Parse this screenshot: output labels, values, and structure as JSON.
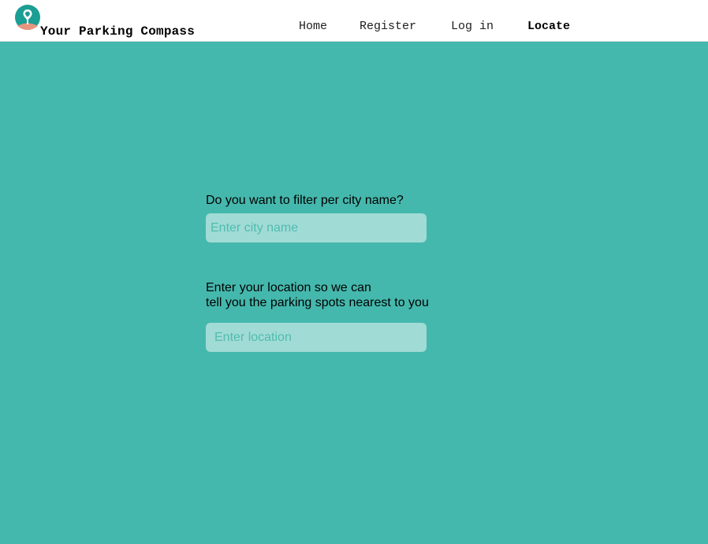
{
  "header": {
    "brand": "Your Parking Compass",
    "logo_icon": "map-pin-icon",
    "nav": {
      "home": "Home",
      "register": "Register",
      "login": "Log in",
      "locate": "Locate"
    },
    "active_nav": "locate"
  },
  "form": {
    "city_question": "Do you want to filter per city name?",
    "city_placeholder": "Enter city name",
    "location_prompt_line1": "Enter your location so we can",
    "location_prompt_line2": "tell you the parking spots nearest to you",
    "location_placeholder": "Enter location"
  },
  "colors": {
    "background": "#45b8ad",
    "header_background": "#ffffff",
    "input_background": "#a1dbd5",
    "placeholder": "#4fbcb0",
    "logo_circle": "#1b9e93",
    "logo_accent": "#e8957f"
  }
}
